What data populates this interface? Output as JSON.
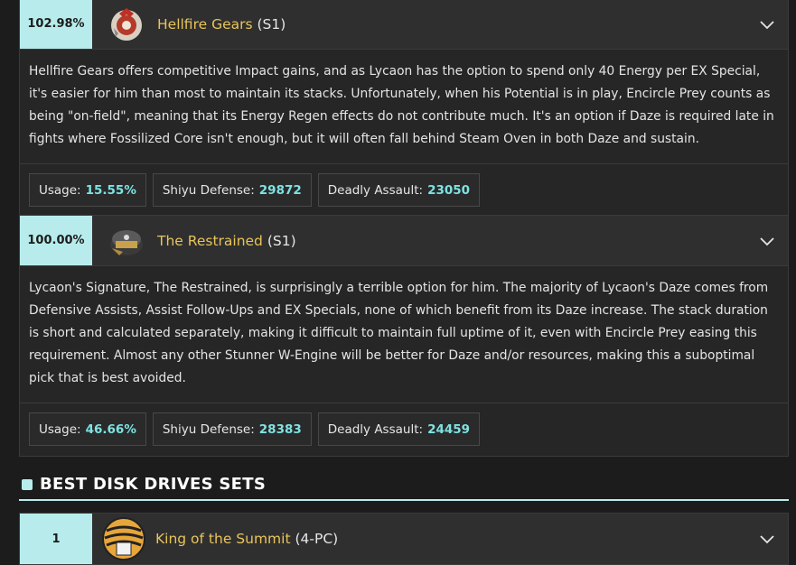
{
  "wengines": [
    {
      "percent": "102.98%",
      "name": "Hellfire Gears",
      "tag": "(S1)",
      "description": "Hellfire Gears offers competitive Impact gains, and as Lycaon has the option to spend only 40 Energy per EX Special, it's easier for him than most to maintain its stacks. Unfortunately, when his Potential is in play, Encircle Prey counts as being \"on-field\", meaning that its Energy Regen effects do not contribute much. It's an option if Daze is required late in fights where Fossilized Core isn't enough, but it will often fall behind Steam Oven in both Daze and sustain.",
      "stats": [
        {
          "label": "Usage:",
          "value": "15.55%"
        },
        {
          "label": "Shiyu Defense:",
          "value": "29872"
        },
        {
          "label": "Deadly Assault:",
          "value": "23050"
        }
      ]
    },
    {
      "percent": "100.00%",
      "name": "The Restrained",
      "tag": "(S1)",
      "description": "Lycaon's Signature, The Restrained, is surprisingly a terrible option for him. The majority of Lycaon's Daze comes from Defensive Assists, Assist Follow-Ups and EX Specials, none of which benefit from its Daze increase. The stack duration is short and calculated separately, making it difficult to maintain full uptime of it, even with Encircle Prey easing this requirement. Almost any other Stunner W-Engine will be better for Daze and/or resources, making this a suboptimal pick that is best avoided.",
      "stats": [
        {
          "label": "Usage:",
          "value": "46.66%"
        },
        {
          "label": "Shiyu Defense:",
          "value": "28383"
        },
        {
          "label": "Deadly Assault:",
          "value": "24459"
        }
      ]
    }
  ],
  "disk_section": {
    "title": "BEST DISK DRIVES SETS",
    "items": [
      {
        "rank": "1",
        "name": "King of the Summit",
        "tag": "(4-PC)"
      }
    ]
  },
  "colors": {
    "accent": "#b8ecec",
    "gold": "#e8c45a",
    "value": "#7fe2e2"
  },
  "icons": [
    "hellfire-gears-icon",
    "the-restrained-icon",
    "king-of-the-summit-icon",
    "chevron-down-icon"
  ]
}
